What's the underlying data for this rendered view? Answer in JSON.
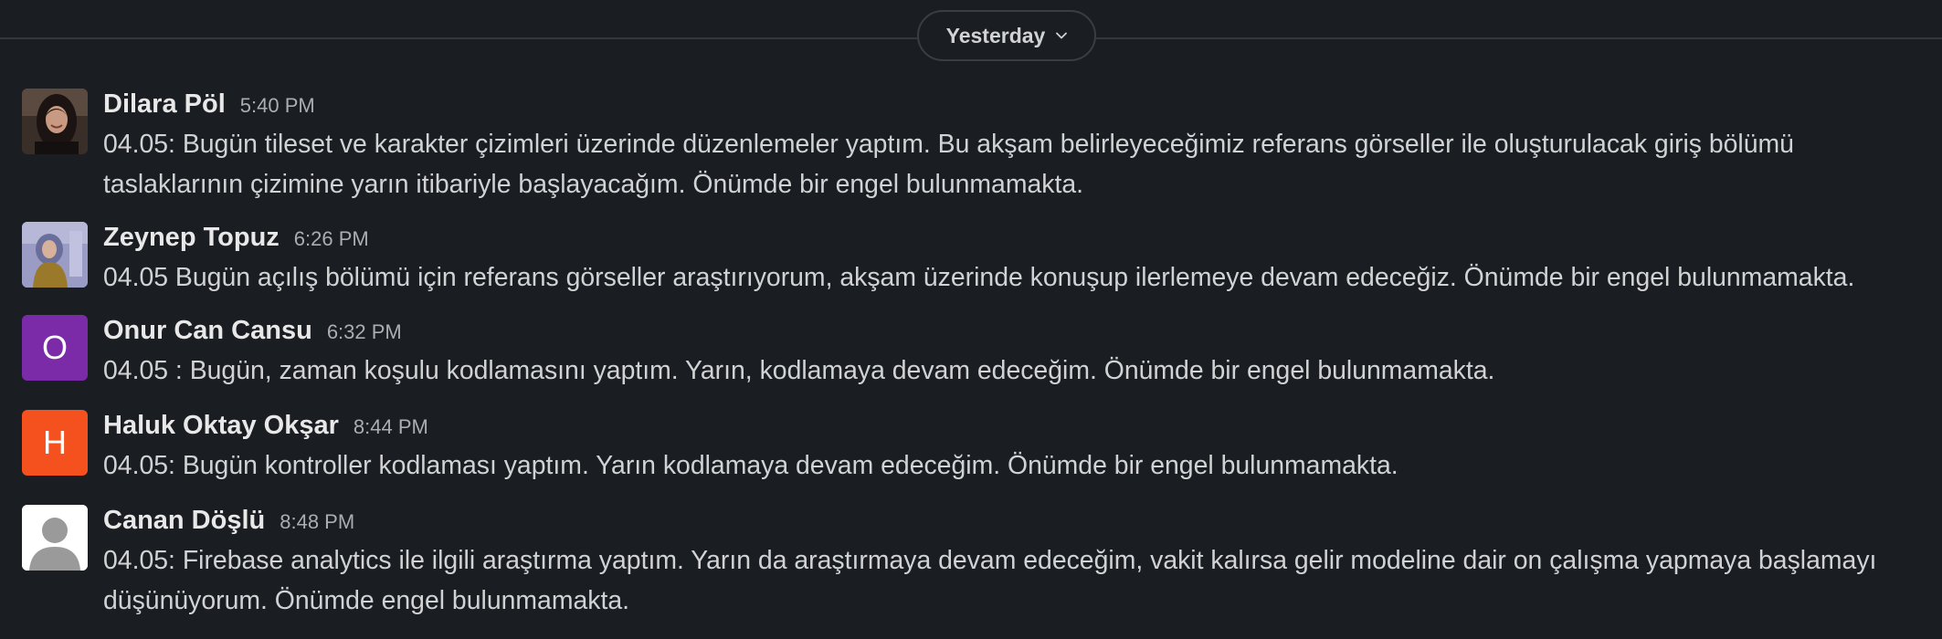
{
  "date_divider": {
    "label": "Yesterday"
  },
  "colors": {
    "background": "#1a1d21",
    "avatar_onur": "#7c2ba8",
    "avatar_haluk": "#f4511e",
    "avatar_canan": "#ffffff"
  },
  "messages": [
    {
      "sender": "Dilara Pöl",
      "time": "5:40 PM",
      "avatar": {
        "type": "photo",
        "icon": "user-photo"
      },
      "text": "04.05: Bugün tileset ve karakter çizimleri üzerinde düzenlemeler yaptım. Bu akşam belirleyeceğimiz referans görseller ile oluşturulacak giriş bölümü taslaklarının çizimine yarın itibariyle başlayacağım. Önümde bir engel bulunmamakta."
    },
    {
      "sender": "Zeynep Topuz",
      "time": "6:26 PM",
      "avatar": {
        "type": "photo",
        "icon": "user-photo"
      },
      "text": "04.05 Bugün açılış bölümü için referans görseller araştırıyorum, akşam üzerinde konuşup ilerlemeye devam edeceğiz. Önümde bir engel bulunmamakta."
    },
    {
      "sender": "Onur Can Cansu",
      "time": "6:32 PM",
      "avatar": {
        "type": "initial",
        "initial": "O",
        "color": "#7c2ba8"
      },
      "text": "04.05 : Bugün, zaman koşulu kodlamasını yaptım. Yarın, kodlamaya devam edeceğim. Önümde bir engel bulunmamakta."
    },
    {
      "sender": "Haluk Oktay Okşar",
      "time": "8:44 PM",
      "avatar": {
        "type": "initial",
        "initial": "H",
        "color": "#f4511e"
      },
      "text": "04.05: Bugün kontroller kodlaması yaptım. Yarın kodlamaya devam edeceğim. Önümde bir engel bulunmamakta."
    },
    {
      "sender": "Canan Döşlü",
      "time": "8:48 PM",
      "avatar": {
        "type": "default",
        "icon": "default-user-icon"
      },
      "text": "04.05: Firebase analytics ile ilgili araştırma yaptım. Yarın da araştırmaya devam edeceğim, vakit kalırsa gelir modeline dair on çalışma yapmaya başlamayı düşünüyorum. Önümde engel bulunmamakta."
    }
  ]
}
